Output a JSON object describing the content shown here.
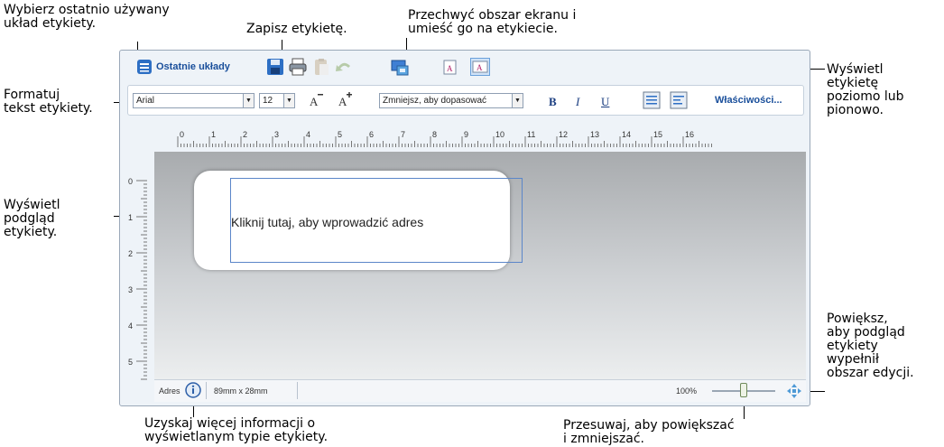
{
  "callouts": {
    "recent_layout": "Wybierz ostatnio używany\nukład etykiety.",
    "save_label": "Zapisz etykietę.",
    "capture": "Przechwyć obszar ekranu i\numieść go na etykiecie.",
    "orientation": "Wyświetl\netykietę\npoziomo lub\npionowo.",
    "format_text": "Formatuj\ntekst etykiety.",
    "preview": "Wyświetl\npodgląd\netykiety.",
    "zoom_fit": "Powiększ,\naby podgląd\netykiety\nwypełnił\nobszar edycji.",
    "info": "Uzyskaj więcej informacji o\nwyświetlanym typie etykiety.",
    "slider": "Przesuwaj, aby powiększać\ni zmniejszać."
  },
  "toolbar": {
    "recent_layouts_label": "Ostatnie układy",
    "font_name": "Arial",
    "font_size": "12",
    "fit_mode": "Zmniejsz, aby dopasować",
    "bold": "B",
    "italic": "I",
    "underline": "U",
    "properties_label": "Właściwości..."
  },
  "ruler": {
    "horizontal": [
      "0",
      "1",
      "2",
      "3",
      "4",
      "5",
      "6",
      "7",
      "8",
      "9",
      "10",
      "11",
      "12",
      "13",
      "14",
      "15",
      "16"
    ],
    "vertical": [
      "0",
      "1",
      "2",
      "3",
      "4",
      "5"
    ]
  },
  "label": {
    "placeholder_text": "Kliknij tutaj, aby wprowadzić adres"
  },
  "status": {
    "label_type": "Adres",
    "size": "89mm x 28mm",
    "zoom": "100%",
    "zoom_value": 1.0
  },
  "colors": {
    "accent": "#1a4f9b",
    "label_border": "#5b86c9",
    "canvas_top": "#a8abae"
  }
}
